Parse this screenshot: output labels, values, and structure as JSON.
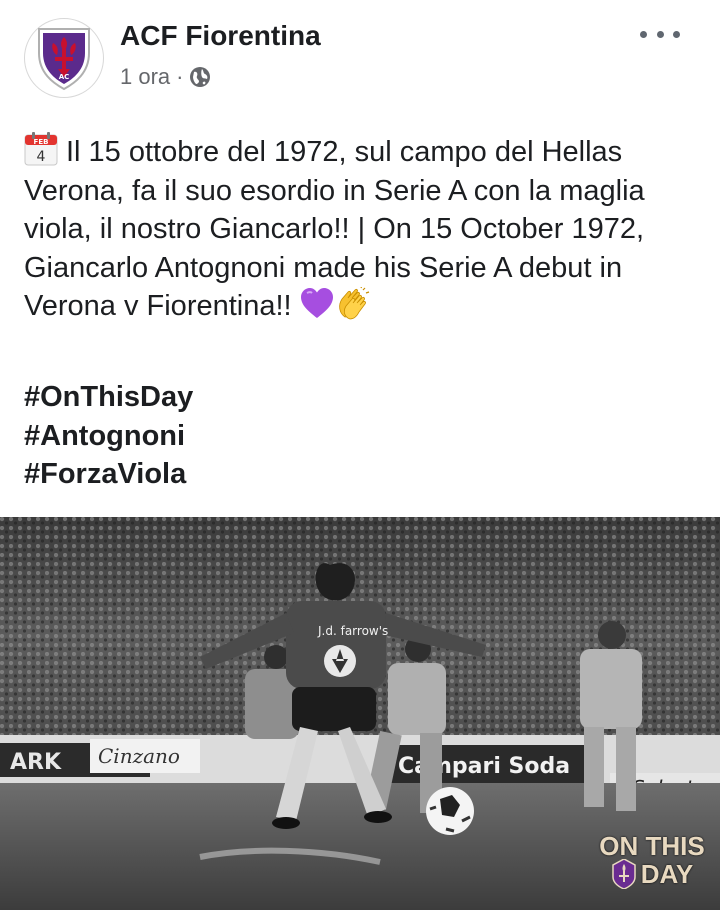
{
  "post": {
    "page_name": "ACF Fiorentina",
    "time": "1 ora",
    "separator": "·",
    "audience_icon": "globe-icon",
    "more_icon": "more-options-icon",
    "avatar_icon": "fiorentina-crest-icon",
    "calendar_emoji": {
      "icon": "calendar-emoji-icon",
      "month": "FEB",
      "day": "4"
    },
    "text": "Il 15 ottobre del 1972, sul campo del Hellas Verona, fa il suo esordio in Serie A con la maglia viola, il nostro Giancarlo!! | On 15 October 1972, Giancarlo Antognoni made his Serie A debut in Verona v Fiorentina!!",
    "emojis": [
      "purple-heart-emoji",
      "clapping-hands-emoji"
    ],
    "hashtags": [
      "#OnThisDay",
      "#Antognoni",
      "#ForzaViola"
    ]
  },
  "photo": {
    "description_icon": "football-match-photo",
    "badge": {
      "line1": "ON THIS",
      "line2": "DAY"
    },
    "shirt_sponsor_text": "J.d. farrow's",
    "billboards": [
      "Cinzano",
      "Campari Soda",
      "Select"
    ]
  },
  "colors": {
    "text": "#1c1e21",
    "meta": "#65676b",
    "viola": "#6a2c91",
    "badge": "#e8d9c0"
  }
}
